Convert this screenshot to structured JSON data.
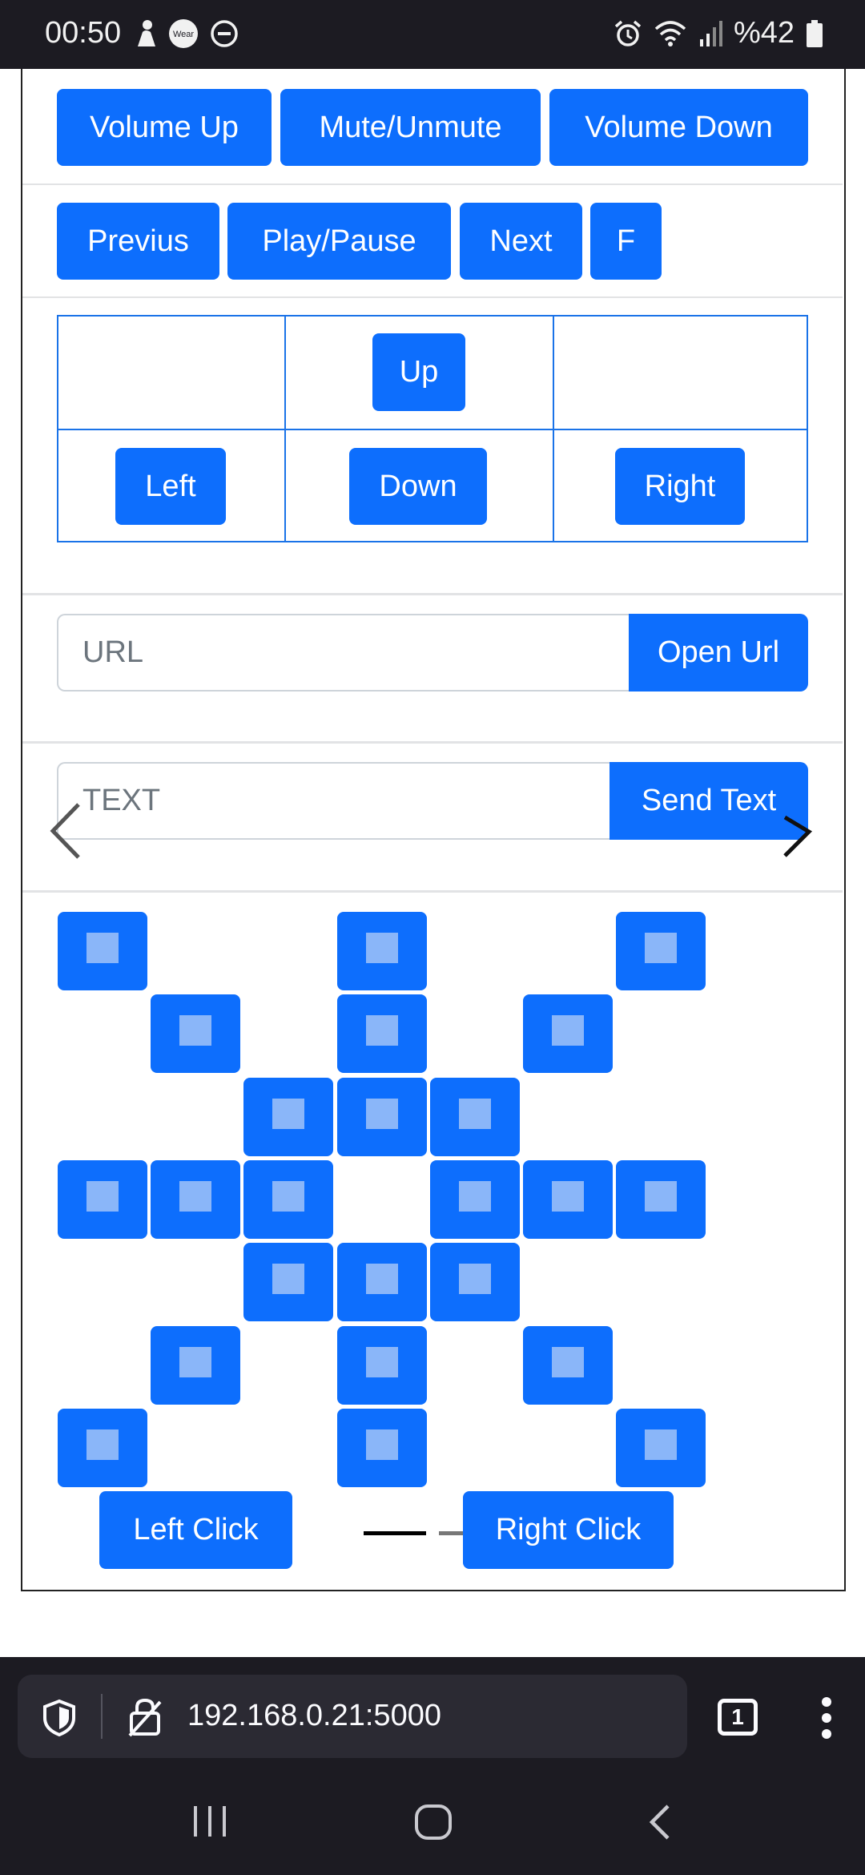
{
  "status_bar": {
    "time": "00:50",
    "battery": "%42",
    "icons": [
      "person-icon",
      "wear-icon",
      "dnd-icon",
      "alarm-icon",
      "wifi-icon",
      "signal-icon",
      "battery-icon"
    ],
    "wear_label": "Wear"
  },
  "media": {
    "volume_up": "Volume Up",
    "mute": "Mute/Unmute",
    "volume_down": "Volume Down",
    "previous": "Previus",
    "play_pause": "Play/Pause",
    "next": "Next",
    "f": "F"
  },
  "dpad": {
    "up": "Up",
    "left": "Left",
    "down": "Down",
    "right": "Right"
  },
  "url_form": {
    "placeholder": "URL",
    "button": "Open Url"
  },
  "text_form": {
    "placeholder": "TEXT",
    "button": "Send Text"
  },
  "mouse": {
    "left_click": "Left Click",
    "right_click": "Right Click"
  },
  "browser": {
    "url": "192.168.0.21:5000",
    "tab_count": "1"
  },
  "colors": {
    "primary": "#0d6efd",
    "system_bar": "#1c1b22"
  }
}
